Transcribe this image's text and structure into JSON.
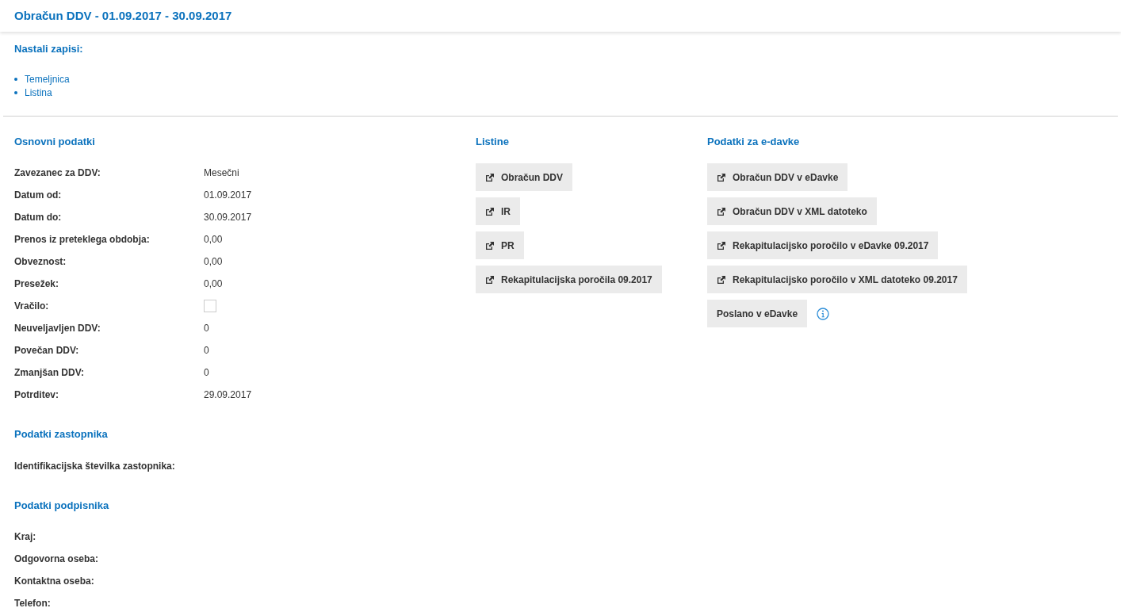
{
  "header": {
    "title": "Obračun DDV - 01.09.2017 - 30.09.2017"
  },
  "records": {
    "title": "Nastali zapisi:",
    "items": [
      "Temeljnica",
      "Listina"
    ]
  },
  "basic": {
    "title": "Osnovni podatki",
    "rows": [
      {
        "kind": "text",
        "label": "Zavezanec za DDV:",
        "value": "Mesečni"
      },
      {
        "kind": "text",
        "label": "Datum od:",
        "value": "01.09.2017"
      },
      {
        "kind": "text",
        "label": "Datum do:",
        "value": "30.09.2017"
      },
      {
        "kind": "text",
        "label": "Prenos iz preteklega obdobja:",
        "value": "0,00"
      },
      {
        "kind": "text",
        "label": "Obveznost:",
        "value": "0,00"
      },
      {
        "kind": "text",
        "label": "Presežek:",
        "value": "0,00"
      },
      {
        "kind": "checkbox",
        "label": "Vračilo:",
        "checked": false
      },
      {
        "kind": "text",
        "label": "Neuveljavljen DDV:",
        "value": "0"
      },
      {
        "kind": "text",
        "label": "Povečan DDV:",
        "value": "0"
      },
      {
        "kind": "text",
        "label": "Zmanjšan DDV:",
        "value": "0"
      },
      {
        "kind": "text",
        "label": "Potrditev:",
        "value": "29.09.2017"
      }
    ]
  },
  "representative": {
    "title": "Podatki zastopnika",
    "rows": [
      {
        "label": "Identifikacijska številka zastopnika:"
      }
    ]
  },
  "signer": {
    "title": "Podatki podpisnika",
    "rows": [
      {
        "label": "Kraj:"
      },
      {
        "label": "Odgovorna oseba:"
      },
      {
        "label": "Kontaktna oseba:"
      },
      {
        "label": "Telefon:"
      }
    ]
  },
  "documents": {
    "title": "Listine",
    "buttons": [
      {
        "kind": "link",
        "label": "Obračun DDV"
      },
      {
        "kind": "link",
        "label": "IR"
      },
      {
        "kind": "link",
        "label": "PR"
      },
      {
        "kind": "link",
        "label": "Rekapitulacijska poročila 09.2017"
      }
    ]
  },
  "edavki": {
    "title": "Podatki za e-davke",
    "buttons": [
      {
        "kind": "link",
        "label": "Obračun DDV v eDavke"
      },
      {
        "kind": "link",
        "label": "Obračun DDV v XML datoteko"
      },
      {
        "kind": "link",
        "label": "Rekapitulacijsko poročilo v eDavke 09.2017"
      },
      {
        "kind": "link",
        "label": "Rekapitulacijsko poročilo v XML datoteko 09.2017"
      },
      {
        "kind": "info",
        "label": "Poslano v eDavke"
      }
    ]
  }
}
